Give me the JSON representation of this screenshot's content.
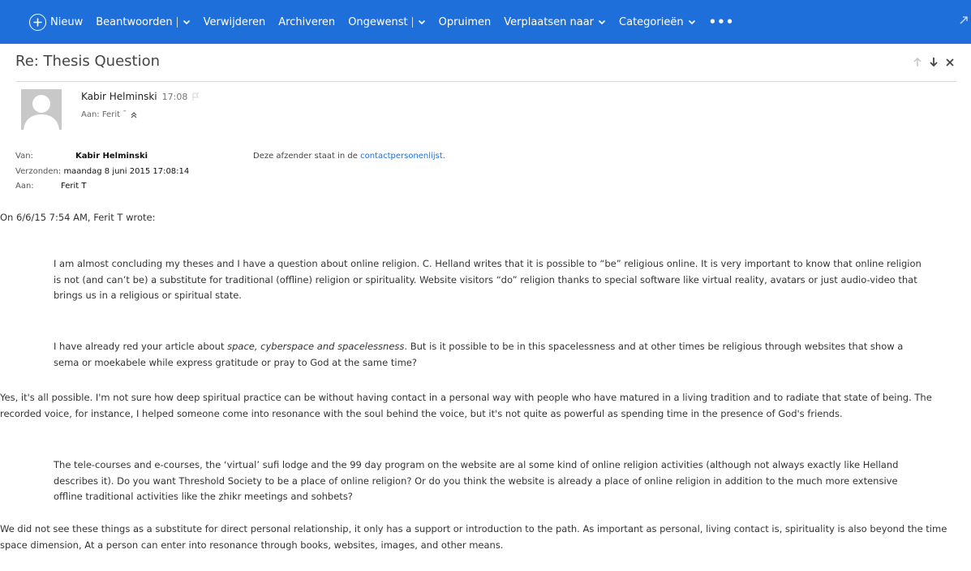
{
  "toolbar": {
    "new_label": "Nieuw",
    "reply_label": "Beantwoorden",
    "delete_label": "Verwijderen",
    "archive_label": "Archiveren",
    "junk_label": "Ongewenst",
    "sweep_label": "Opruimen",
    "move_label": "Verplaatsen naar",
    "categories_label": "Categorieën",
    "more_label": "•••"
  },
  "message": {
    "subject": "Re: Thesis Question",
    "sender_name": "Kabir Helminski",
    "time": "17:08",
    "to_label": "Aan: Ferit ¯"
  },
  "meta": {
    "from_label": "Van:",
    "from_value": "Kabir Helminski",
    "sent_label": "Verzonden:",
    "sent_value": "maandag 8 juni 2015 17:08:14",
    "to_label": "Aan:",
    "to_value": "Ferit T",
    "notice_text": "Deze afzender staat in de ",
    "notice_link": "contactpersonenlijst."
  },
  "body": {
    "quote_intro": "On 6/6/15 7:54 AM, Ferit T wrote:",
    "p1": "I am almost concluding my theses and I have a question about online religion. C. Helland writes that it is possible to “be” religious online. It is very important to know that online religion is not (and can’t be) a substitute for traditional (offline) religion or spirituality. Website visitors “do” religion thanks to special software like virtual reality, avatars or just audio-video that brings us in a religious or spiritual state.",
    "p2_a": "I have already red your article about ",
    "p2_em": "space, cyberspace and spacelessness",
    "p2_b": ". But is it possible to be in this spacelessness and at other times be religious through websites that show a sema or moekabele while express gratitude or pray to God at the same time?",
    "r1": "Yes, it's all possible. I'm not sure how deep spiritual practice can be without having contact in a personal way with people who have matured in a living tradition and to radiate that state of being. The recorded voice, for instance, I helped someone come into resonance with the soul behind the voice, but it's not quite as powerful as spending time in the presence of God's friends.",
    "p3": "The tele-courses and  e-courses, the ‘virtual’ sufi lodge and the 99 day program on the website are al some kind of online religion activities (although not always exactly like Helland describes it). Do you want Threshold Society to be a place of online religion? Or do you think the website is already a place of online religion in addition to the much more extensive offline traditional activities like the zhikr meetings and sohbets?",
    "r2": "We did not see these things as a substitute for direct personal relationship, it only has a support or introduction to the path. As important as personal, living contact is, spirituality is also beyond the time space dimension, At a person can enter into resonance through books, websites, images, and other means."
  },
  "colors": {
    "toolbar_bg": "#1e6fd9",
    "link": "#1e6fd9"
  }
}
